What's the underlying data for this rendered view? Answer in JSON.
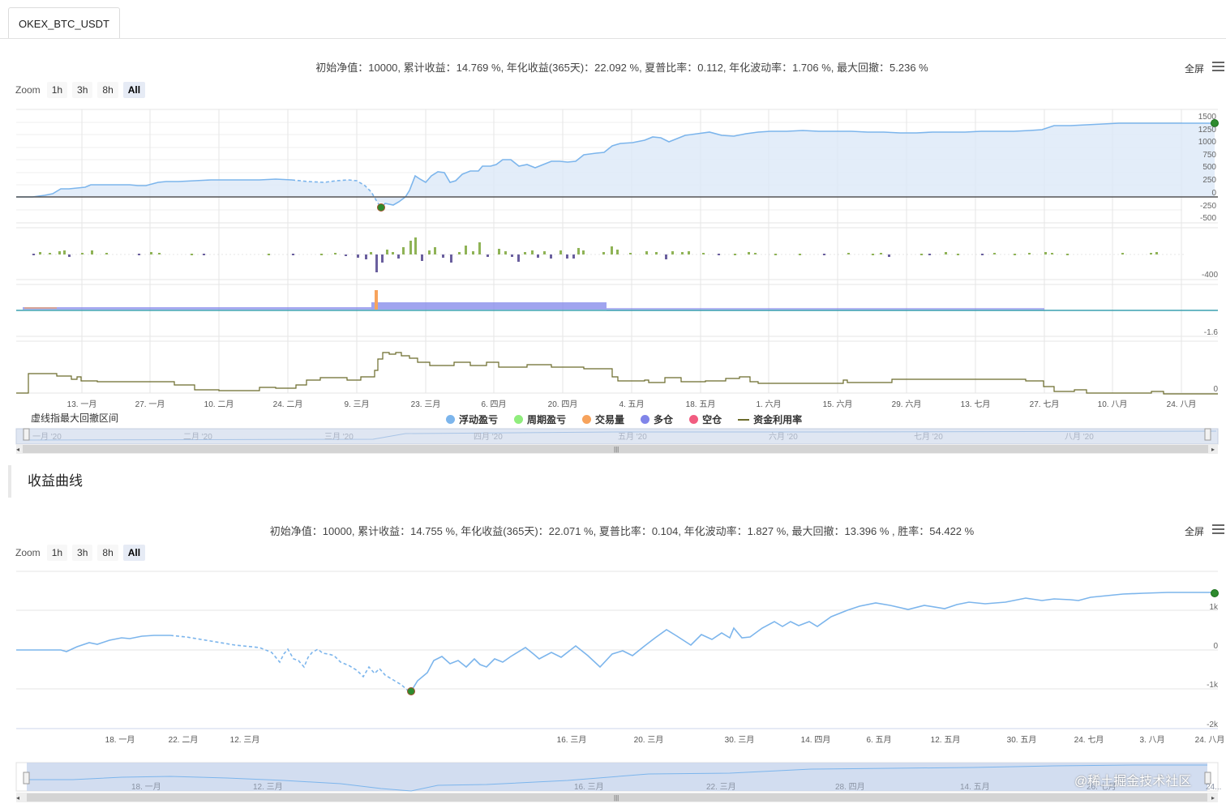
{
  "tab": {
    "label": "OKEX_BTC_USDT"
  },
  "chart1": {
    "stats": "初始净值：10000, 累计收益：14.769 %, 年化收益(365天)：22.092 %, 夏普比率：0.112, 年化波动率：1.706 %, 最大回撤：5.236 %",
    "zoom_label": "Zoom",
    "zoom_buttons": [
      "1h",
      "3h",
      "8h",
      "All"
    ],
    "fullscreen": "全屏",
    "y_ticks": [
      "1500",
      "1250",
      "1000",
      "750",
      "500",
      "250",
      "0",
      "-250",
      "-500"
    ],
    "pane2_tick": "-400",
    "pane3_tick": "-1.6",
    "pane4_tick": "0",
    "x_ticks": [
      "13. 一月",
      "27. 一月",
      "10. 二月",
      "24. 二月",
      "9. 三月",
      "23. 三月",
      "6. 四月",
      "20. 四月",
      "4. 五月",
      "18. 五月",
      "1. 六月",
      "15. 六月",
      "29. 六月",
      "13. 七月",
      "27. 七月",
      "10. 八月",
      "24. 八月"
    ],
    "navigator_labels": [
      "一月 '20",
      "二月 '20",
      "三月 '20",
      "四月 '20",
      "五月 '20",
      "六月 '20",
      "七月 '20",
      "八月 '20"
    ],
    "note": "虚线指最大回撤区间",
    "legend": [
      {
        "label": "浮动盈亏",
        "color": "#7cb5ec",
        "icon": "circle"
      },
      {
        "label": "周期盈亏",
        "color": "#90ed7d",
        "icon": "circle"
      },
      {
        "label": "交易量",
        "color": "#f7a35c",
        "icon": "circle"
      },
      {
        "label": "多仓",
        "color": "#8085e9",
        "icon": "circle"
      },
      {
        "label": "空仓",
        "color": "#f15c80",
        "icon": "circle"
      },
      {
        "label": "资金利用率",
        "color": "#6b6b2a",
        "icon": "line"
      }
    ]
  },
  "section": {
    "title": "收益曲线"
  },
  "chart2": {
    "stats": "初始净值：10000, 累计收益：14.755 %, 年化收益(365天)：22.071 %, 夏普比率：0.104, 年化波动率：1.827 %, 最大回撤：13.396 % , 胜率：54.422 %",
    "zoom_label": "Zoom",
    "zoom_buttons": [
      "1h",
      "3h",
      "8h",
      "All"
    ],
    "fullscreen": "全屏",
    "y_ticks": [
      "1k",
      "0",
      "-1k",
      "-2k"
    ],
    "x_ticks": [
      "18. 一月",
      "22. 二月",
      "12. 三月",
      "16. 三月",
      "20. 三月",
      "30. 三月",
      "14. 四月",
      "6. 五月",
      "12. 五月",
      "30. 五月",
      "24. 七月",
      "3. 八月",
      "24. 八月"
    ],
    "navigator_labels": [
      "18. 一月",
      "12. 三月",
      "16. 三月",
      "22. 三月",
      "28. 四月",
      "14. 五月",
      "26. 七月",
      "24..."
    ]
  },
  "colors": {
    "line": "#7cb5ec",
    "area": "#dce9f8",
    "marker": "#2e8b2e",
    "bar_green": "#8fb356",
    "bar_purple": "#6a5f9e",
    "util": "#6b6b2a"
  },
  "watermark": "@稀土掘金技术社区"
}
